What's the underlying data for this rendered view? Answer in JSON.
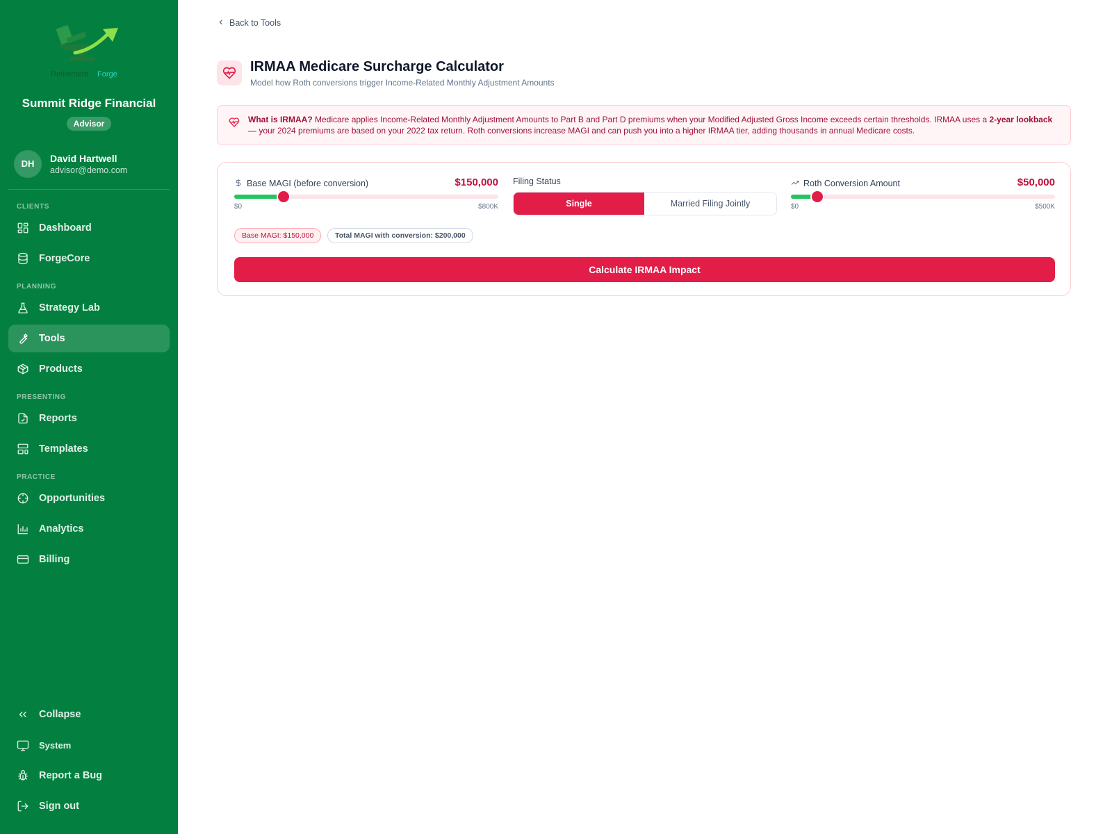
{
  "colors": {
    "sidebar": "#03803f",
    "accent": "#e11d48",
    "accent_text": "#be123c",
    "slider_fill": "#22c55e"
  },
  "sidebar": {
    "logo": {
      "icon": "retirement-forge-logo",
      "text": "RetirementForge"
    },
    "org_name": "Summit Ridge Financial",
    "role": "Advisor",
    "user": {
      "initials": "DH",
      "name": "David Hartwell",
      "email": "advisor@demo.com"
    },
    "sections": {
      "clients": "CLIENTS",
      "planning": "PLANNING",
      "presenting": "PRESENTING",
      "practice": "PRACTICE"
    },
    "items": {
      "dashboard": {
        "label": "Dashboard",
        "icon": "layout-grid-icon"
      },
      "forgecore": {
        "label": "ForgeCore",
        "icon": "database-icon"
      },
      "strategy_lab": {
        "label": "Strategy Lab",
        "icon": "flask-icon"
      },
      "tools": {
        "label": "Tools",
        "icon": "wrench-icon",
        "active": true
      },
      "products": {
        "label": "Products",
        "icon": "box-icon"
      },
      "reports": {
        "label": "Reports",
        "icon": "file-check-icon"
      },
      "templates": {
        "label": "Templates",
        "icon": "layout-template-icon"
      },
      "opportunities": {
        "label": "Opportunities",
        "icon": "crosshair-icon"
      },
      "analytics": {
        "label": "Analytics",
        "icon": "bar-chart-icon"
      },
      "billing": {
        "label": "Billing",
        "icon": "credit-card-icon"
      }
    },
    "footer": {
      "collapse": "Collapse",
      "system": "System",
      "report_bug": "Report a Bug",
      "sign_out": "Sign out"
    }
  },
  "main": {
    "back_link": "Back to Tools",
    "title": "IRMAA Medicare Surcharge Calculator",
    "subtitle": "Model how Roth conversions trigger Income-Related Monthly Adjustment Amounts",
    "info": {
      "lead": "What is IRMAA?",
      "text1": " Medicare applies Income-Related Monthly Adjustment Amounts to Part B and Part D premiums when your Modified Adjusted Gross Income exceeds certain thresholds. IRMAA uses a ",
      "bold": "2-year lookback",
      "text2": " — your 2024 premiums are based on your 2022 tax return. Roth conversions increase MAGI and can push you into a higher IRMAA tier, adding thousands in annual Medicare costs."
    },
    "base_magi": {
      "label": "Base MAGI (before conversion)",
      "value": "$150,000",
      "min": "$0",
      "max": "$800K",
      "fraction": 0.1875
    },
    "filing_status": {
      "label": "Filing Status",
      "options": [
        "Single",
        "Married Filing Jointly"
      ],
      "selected": "Single"
    },
    "roth_conversion": {
      "label": "Roth Conversion Amount",
      "value": "$50,000",
      "min": "$0",
      "max": "$500K",
      "fraction": 0.1
    },
    "chips": {
      "base": "Base MAGI: $150,000",
      "total": "Total MAGI with conversion: $200,000"
    },
    "calculate_button": "Calculate IRMAA Impact"
  }
}
